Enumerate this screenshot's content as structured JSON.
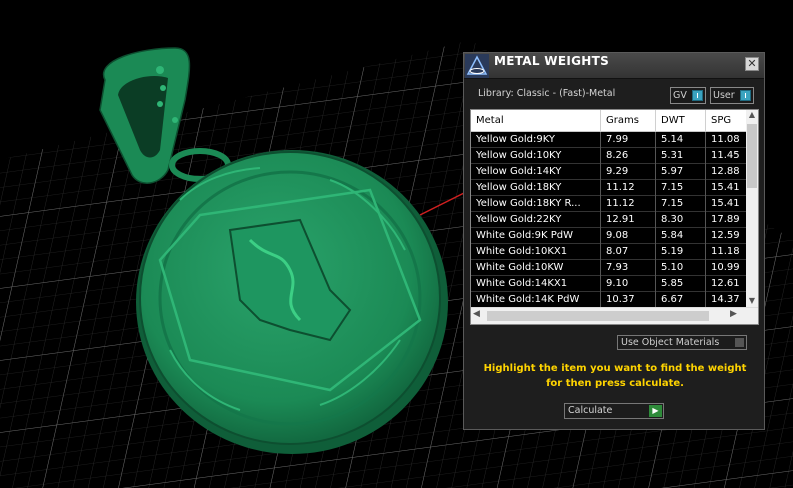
{
  "panel": {
    "title": "METAL WEIGHTS",
    "close_glyph": "✕",
    "library_label": "Library: Classic - (Fast)-Metal",
    "gv_label": "GV",
    "user_label": "User",
    "accent_color": "#3aa3c0"
  },
  "table": {
    "columns": [
      "Metal",
      "Grams",
      "DWT",
      "SPG"
    ],
    "rows": [
      [
        "Yellow Gold:9KY",
        "7.99",
        "5.14",
        "11.08"
      ],
      [
        "Yellow Gold:10KY",
        "8.26",
        "5.31",
        "11.45"
      ],
      [
        "Yellow Gold:14KY",
        "9.29",
        "5.97",
        "12.88"
      ],
      [
        "Yellow Gold:18KY",
        "11.12",
        "7.15",
        "15.41"
      ],
      [
        "Yellow Gold:18KY R...",
        "11.12",
        "7.15",
        "15.41"
      ],
      [
        "Yellow Gold:22KY",
        "12.91",
        "8.30",
        "17.89"
      ],
      [
        "White Gold:9K PdW",
        "9.08",
        "5.84",
        "12.59"
      ],
      [
        "White Gold:10KX1",
        "8.07",
        "5.19",
        "11.18"
      ],
      [
        "White Gold:10KW",
        "7.93",
        "5.10",
        "10.99"
      ],
      [
        "White Gold:14KX1",
        "9.10",
        "5.85",
        "12.61"
      ],
      [
        "White Gold:14K PdW",
        "10.37",
        "6.67",
        "14.37"
      ]
    ],
    "vscroll_up": "▲",
    "vscroll_down": "▼",
    "hscroll_left": "◀",
    "hscroll_right": "▶"
  },
  "use_object_materials_label": "Use Object Materials",
  "instructions": "Highlight the item you want to find the weight for then press calculate.",
  "calculate_label": "Calculate",
  "calculate_go_glyph": "▶",
  "colors": {
    "pendant": "#1f8f5c",
    "instructions_text": "#ffd400",
    "calculate_go": "#2e8b3a"
  }
}
